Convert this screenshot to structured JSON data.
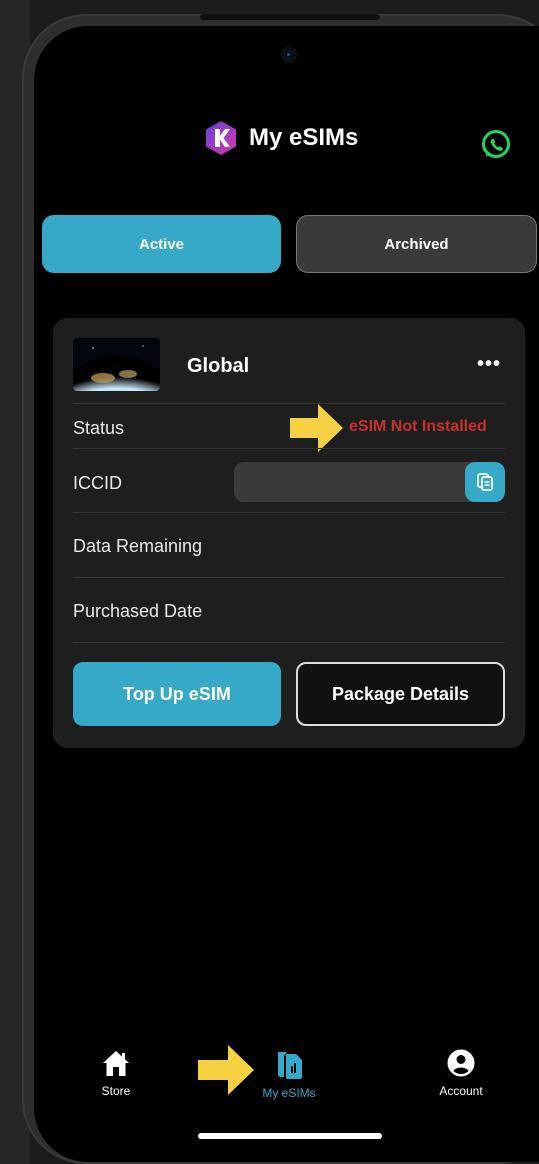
{
  "header": {
    "title": "My eSIMs",
    "logo_icon": "k-logo-icon",
    "support_icon": "whatsapp-icon"
  },
  "tabs": [
    {
      "label": "Active",
      "active": true
    },
    {
      "label": "Archived",
      "active": false
    }
  ],
  "esim_card": {
    "package_name": "Global",
    "more_label": "•••",
    "rows": {
      "status_label": "Status",
      "status_value": "eSIM Not Installed",
      "iccid_label": "ICCID",
      "iccid_value": "",
      "data_remaining_label": "Data Remaining",
      "purchased_date_label": "Purchased Date"
    },
    "top_up_label": "Top Up eSIM",
    "package_details_label": "Package Details"
  },
  "bottom_nav": [
    {
      "label": "Store",
      "icon": "home-icon",
      "active": false
    },
    {
      "label": "My eSIMs",
      "icon": "sim-card-icon",
      "active": true
    },
    {
      "label": "Account",
      "icon": "account-icon",
      "active": false
    }
  ],
  "colors": {
    "accent": "#35a9c7",
    "error": "#c9302c",
    "highlight_arrow": "#f5d142"
  }
}
